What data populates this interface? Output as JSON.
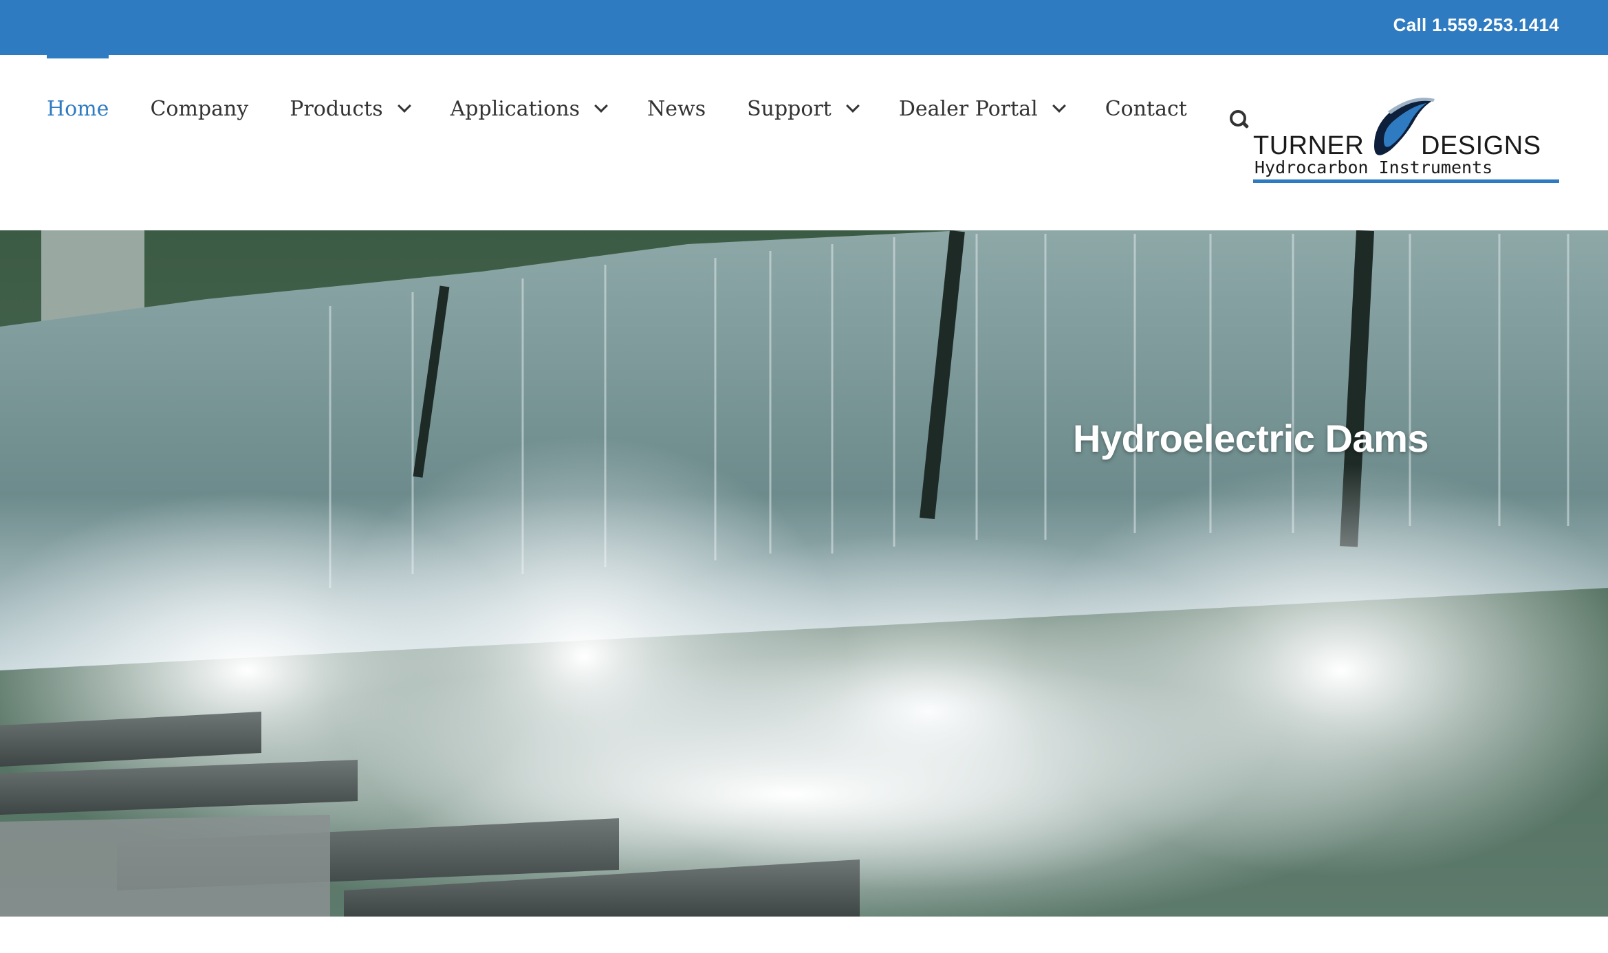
{
  "topbar": {
    "phone": "Call 1.559.253.1414"
  },
  "nav": {
    "items": [
      {
        "label": "Home",
        "active": true,
        "dropdown": false
      },
      {
        "label": "Company",
        "active": false,
        "dropdown": false
      },
      {
        "label": "Products",
        "active": false,
        "dropdown": true
      },
      {
        "label": "Applications",
        "active": false,
        "dropdown": true
      },
      {
        "label": "News",
        "active": false,
        "dropdown": false
      },
      {
        "label": "Support",
        "active": false,
        "dropdown": true
      },
      {
        "label": "Dealer Portal",
        "active": false,
        "dropdown": true
      },
      {
        "label": "Contact",
        "active": false,
        "dropdown": false
      }
    ],
    "search_icon": "search-icon"
  },
  "logo": {
    "line1_left": "TURNER",
    "line1_right": "DESIGNS",
    "line2": "Hydrocarbon Instruments"
  },
  "hero": {
    "title": "Hydroelectric Dams"
  },
  "colors": {
    "brand_blue": "#2f7bc1",
    "nav_text": "#333333",
    "active_nav": "#2f7bc1"
  }
}
